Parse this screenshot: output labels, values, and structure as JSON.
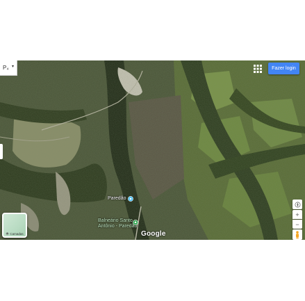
{
  "controls": {
    "menu_label": "P₄",
    "menu_caret": "▾",
    "login_label": "Fazer login",
    "apps_icon": "apps-grid-icon",
    "layers_label": "Camadas",
    "layers_icon": "layers-icon",
    "compass_icon": "compass-icon",
    "zoom_in_label": "+",
    "zoom_out_label": "−",
    "pegman_icon": "pegman-icon"
  },
  "map": {
    "places": [
      {
        "name": "Paredão",
        "pin": "pin-icon",
        "color": "#4fc3f7"
      },
      {
        "name_line1": "Balneário Santo",
        "name_line2": "Antônio - Paredão",
        "pin": "park-icon",
        "color": "#34a853"
      }
    ],
    "logo": "Google"
  },
  "colors": {
    "accent": "#4285f4",
    "water_pin": "#4fc3f7",
    "park_pin": "#34a853"
  }
}
